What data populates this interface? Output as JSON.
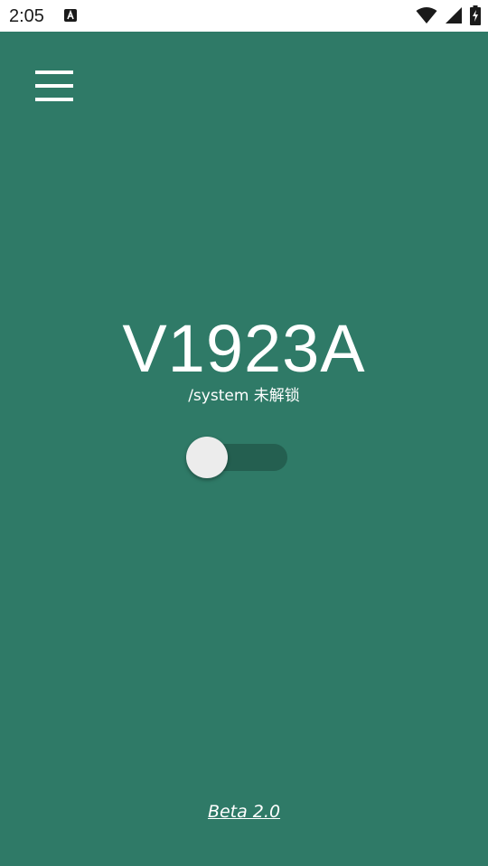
{
  "status_bar": {
    "time": "2:05",
    "notification_icon": "a-badge-icon",
    "wifi_icon": "wifi-icon",
    "signal_icon": "signal-icon",
    "battery_icon": "battery-charging-icon"
  },
  "toolbar": {
    "menu_icon": "hamburger-menu-icon"
  },
  "main": {
    "device_model": "V1923A",
    "system_status": "/system 未解锁",
    "switch_on": false
  },
  "footer": {
    "version": "Beta 2.0"
  },
  "colors": {
    "background": "#2f7a67",
    "switch_track": "#245f50",
    "switch_thumb": "#ececec",
    "status_bar": "#ffffff"
  }
}
